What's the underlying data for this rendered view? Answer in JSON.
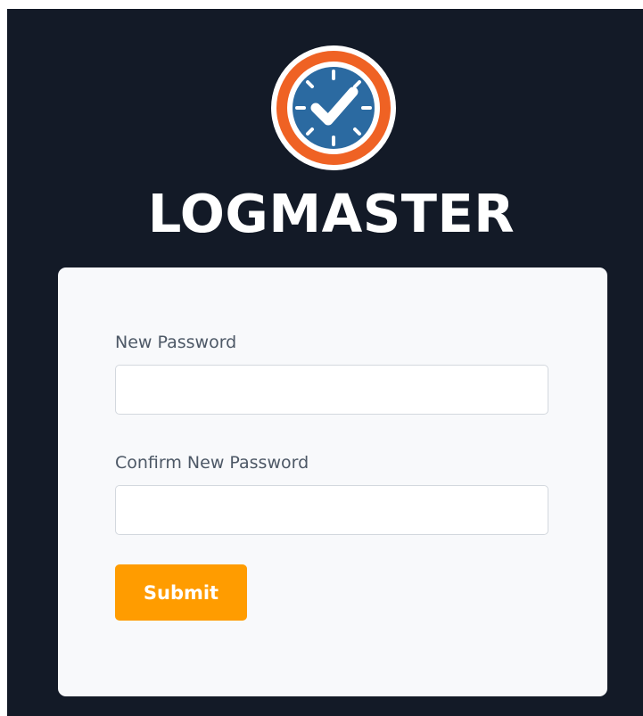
{
  "brand": {
    "name": "LOGMASTER",
    "logo_icon": "clock-check-icon",
    "colors": {
      "background": "#131a27",
      "logo_ring_outer": "#ef6224",
      "logo_face": "#2b6aa1",
      "accent": "#ff9c00"
    }
  },
  "form": {
    "new_password": {
      "label": "New Password",
      "value": "",
      "placeholder": ""
    },
    "confirm_password": {
      "label": "Confirm New Password",
      "value": "",
      "placeholder": ""
    },
    "submit_label": "Submit"
  }
}
